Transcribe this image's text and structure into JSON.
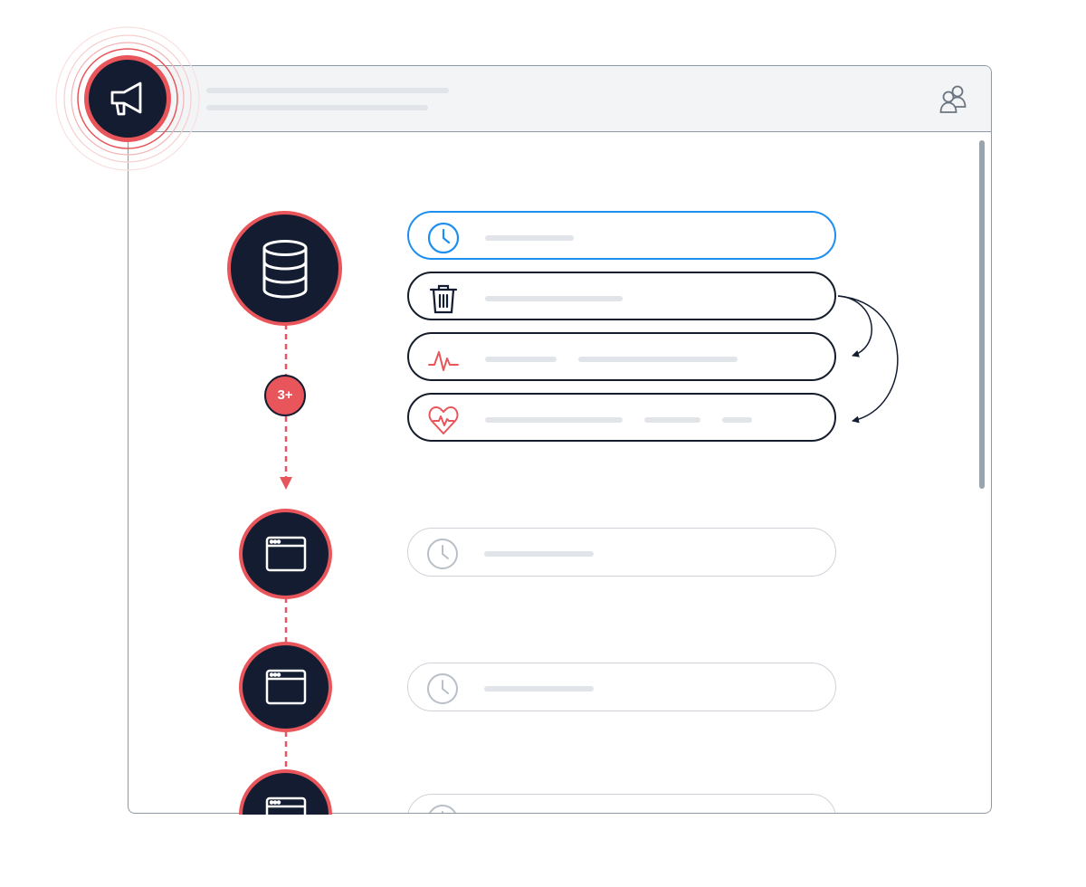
{
  "badge": {
    "label": "3+"
  },
  "colors": {
    "accent": "#e8555a",
    "node_fill": "#131c30",
    "active_border": "#1e8ff0",
    "placeholder": "#e1e4e8",
    "muted_border": "#cfd3d9"
  },
  "icons": {
    "header_left": "megaphone-icon",
    "header_right": "users-icon",
    "top_node": "database-icon",
    "lower_nodes": "browser-window-icon"
  },
  "rows": [
    {
      "icon": "clock-icon",
      "state": "active"
    },
    {
      "icon": "trash-icon",
      "state": "default"
    },
    {
      "icon": "pulse-icon",
      "state": "default"
    },
    {
      "icon": "heart-pulse-icon",
      "state": "default"
    },
    {
      "icon": "clock-icon",
      "state": "disabled"
    },
    {
      "icon": "clock-icon",
      "state": "disabled"
    },
    {
      "icon": "clock-icon",
      "state": "disabled"
    }
  ]
}
